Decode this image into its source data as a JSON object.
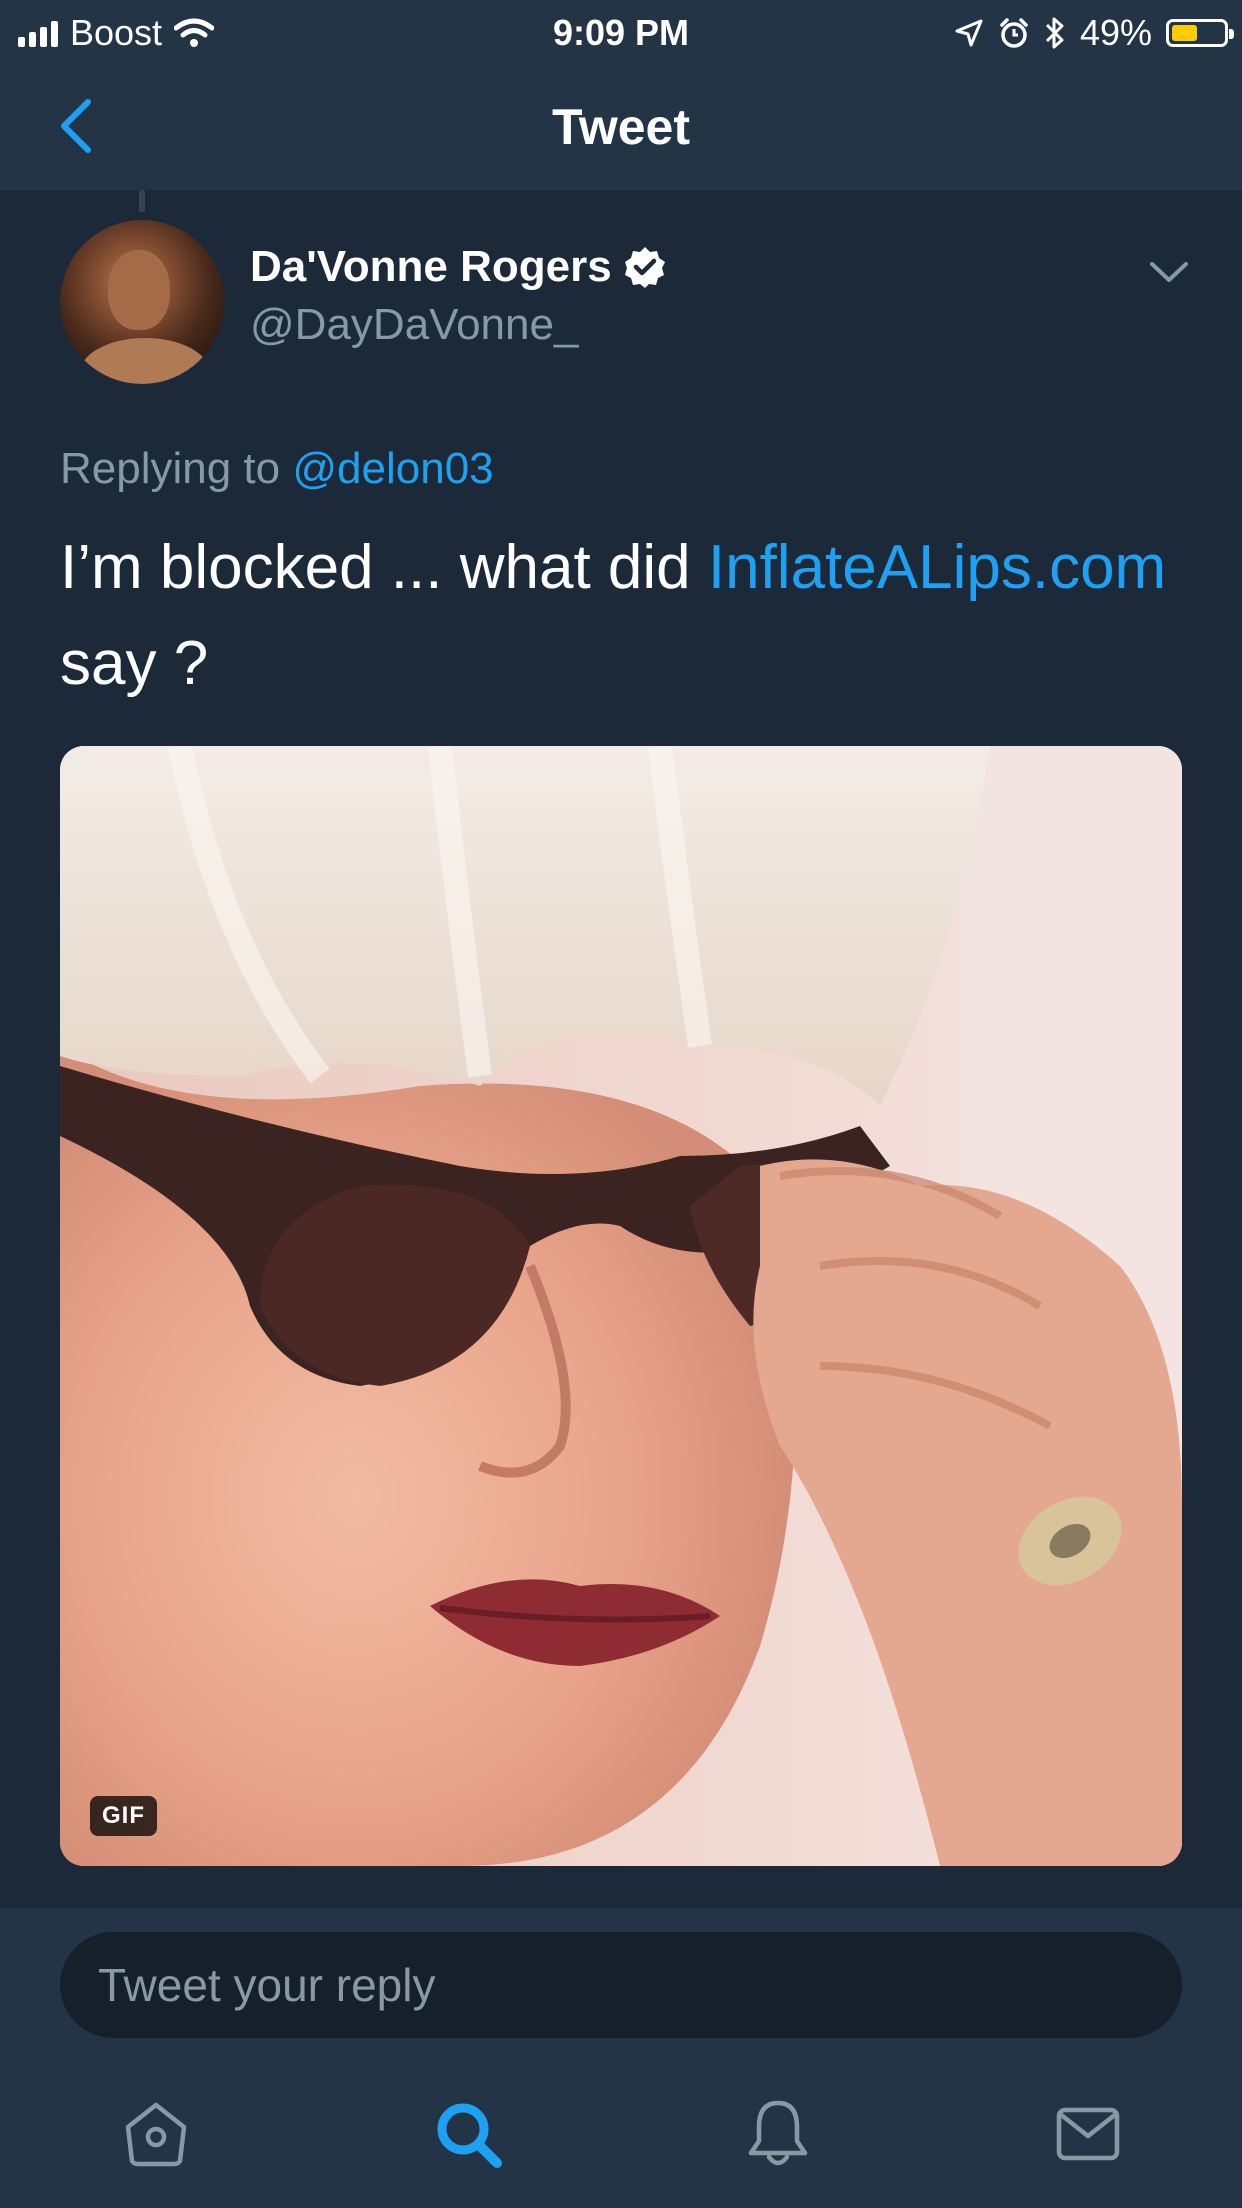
{
  "status_bar": {
    "carrier": "Boost",
    "time": "9:09 PM",
    "battery_percent": "49%",
    "battery_level": 0.49,
    "icons": [
      "signal-icon",
      "wifi-icon",
      "location-icon",
      "alarm-icon",
      "bluetooth-icon",
      "battery-icon"
    ]
  },
  "nav": {
    "title": "Tweet",
    "back_icon": "chevron-left-icon"
  },
  "tweet": {
    "display_name": "Da'Vonne Rogers",
    "handle": "@DayDaVonne_",
    "verified": true,
    "replying_prefix": "Replying to",
    "replying_to": "@delon03",
    "text_before_link": "I’m blocked ... what did ",
    "link_text": "InflateALips.com",
    "text_after_link": " say ?",
    "media_badge": "GIF"
  },
  "reply": {
    "placeholder": "Tweet your reply"
  },
  "tabs": [
    {
      "name": "home",
      "icon": "home-icon"
    },
    {
      "name": "search",
      "icon": "search-icon",
      "active": true
    },
    {
      "name": "notifications",
      "icon": "bell-icon"
    },
    {
      "name": "messages",
      "icon": "mail-icon"
    }
  ],
  "colors": {
    "background": "#1c2938",
    "bar": "#243447",
    "accent": "#1da1f2",
    "secondary_text": "#8899a6",
    "battery": "#ffcc00"
  }
}
